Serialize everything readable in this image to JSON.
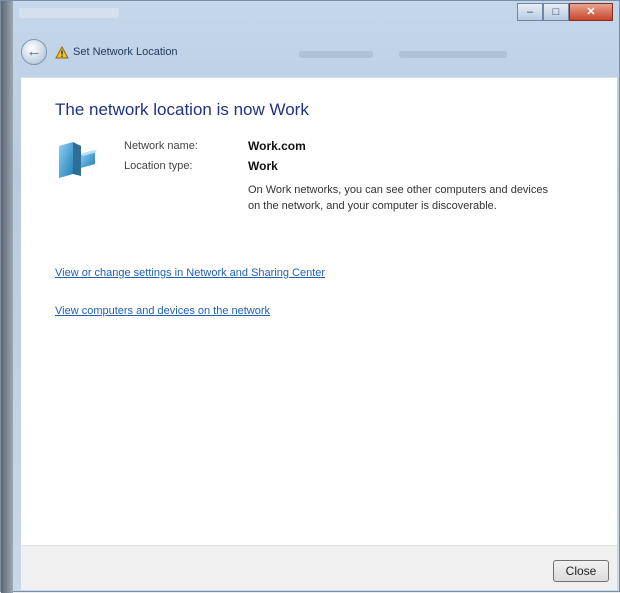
{
  "window": {
    "controls": {
      "minimize": "–",
      "maximize": "□",
      "close": "✕"
    }
  },
  "address": {
    "back_icon": "back-arrow-icon",
    "crumb_icon": "shield-warning-icon",
    "title": "Set Network Location"
  },
  "main": {
    "heading": "The network location is now Work",
    "network_icon": "network-bench-icon",
    "network_name_label": "Network name:",
    "network_name_value": "Work.com",
    "location_type_label": "Location type:",
    "location_type_value": "Work",
    "description": "On Work networks, you can see other computers and devices on the network, and your computer is discoverable.",
    "links": [
      "View or change settings in Network and Sharing Center",
      "View computers and devices on the network"
    ]
  },
  "footer": {
    "close_label": "Close"
  },
  "colors": {
    "heading": "#1e3287",
    "link": "#1f5fb8",
    "titlebar": "#b7cbe0"
  }
}
